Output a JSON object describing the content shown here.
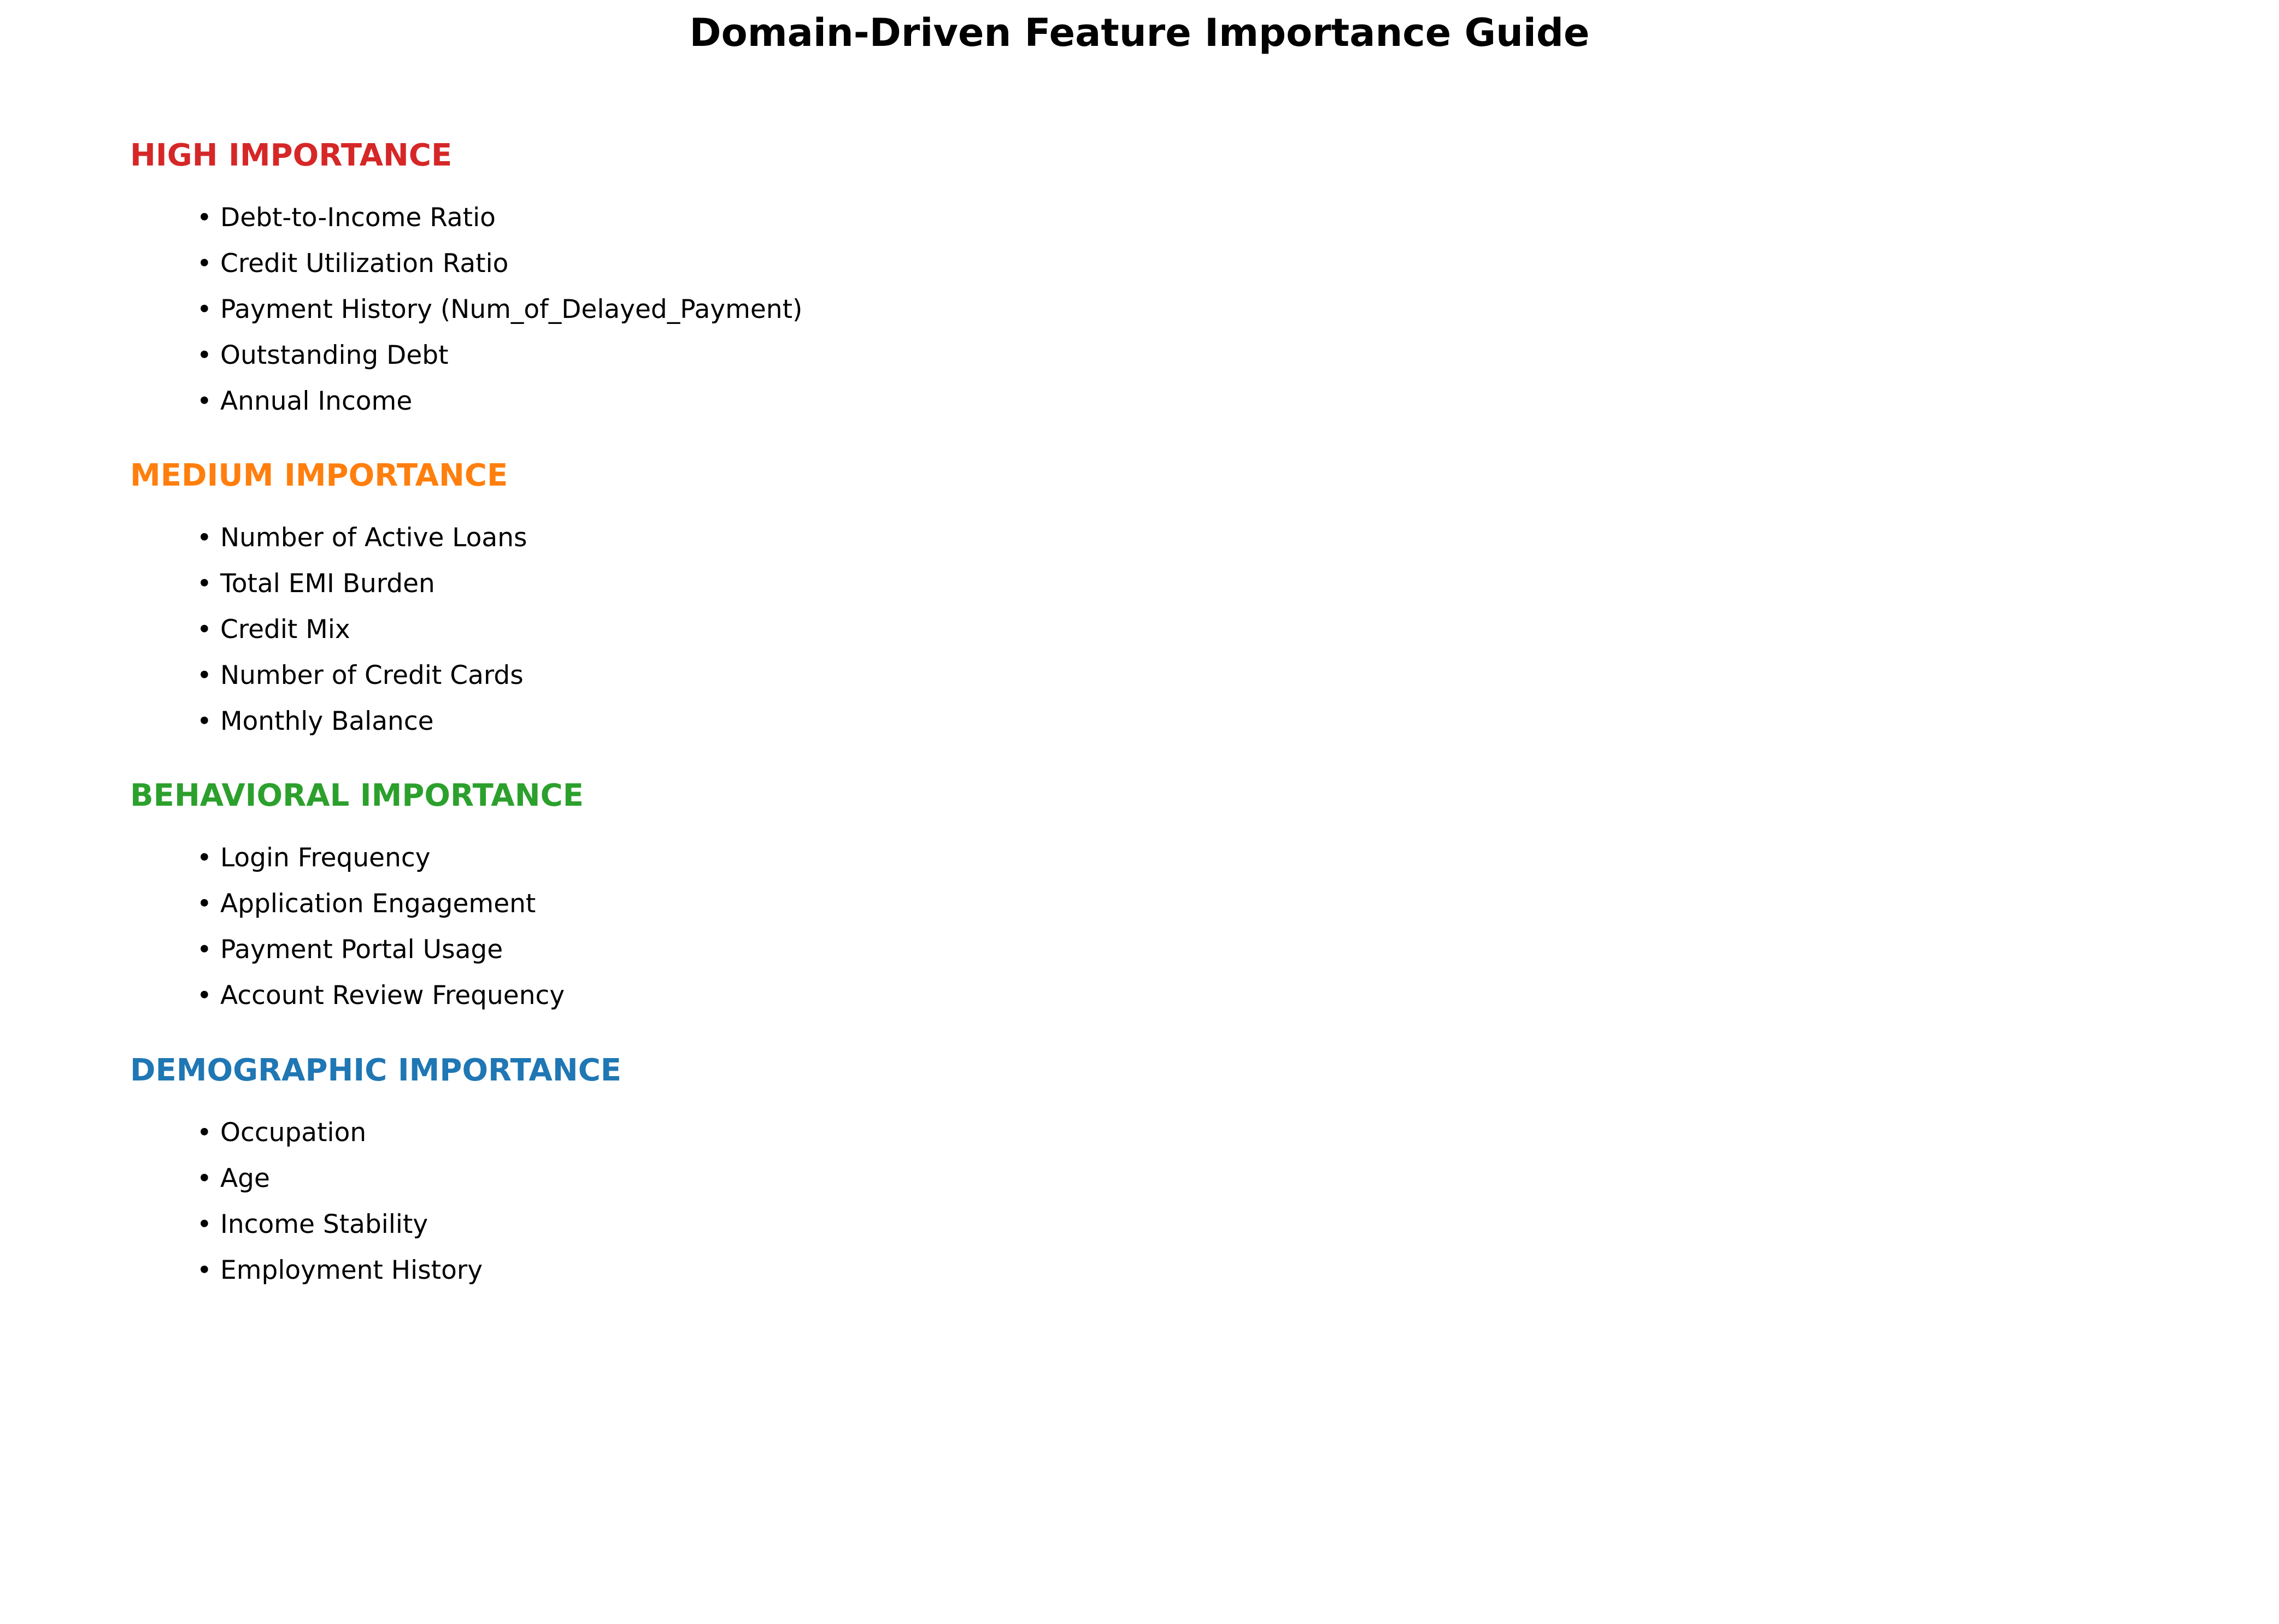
{
  "title": "Domain-Driven Feature Importance Guide",
  "colors": {
    "high": "#d62728",
    "medium": "#ff7f0e",
    "behavioral": "#2ca02c",
    "demographic": "#1f77b4"
  },
  "bullet": "•",
  "sections": [
    {
      "heading": "HIGH IMPORTANCE",
      "items": [
        "Debt-to-Income Ratio",
        "Credit Utilization Ratio",
        "Payment History (Num_of_Delayed_Payment)",
        "Outstanding Debt",
        "Annual Income"
      ]
    },
    {
      "heading": "MEDIUM IMPORTANCE",
      "items": [
        "Number of Active Loans",
        "Total EMI Burden",
        "Credit Mix",
        "Number of Credit Cards",
        "Monthly Balance"
      ]
    },
    {
      "heading": "BEHAVIORAL IMPORTANCE",
      "items": [
        "Login Frequency",
        "Application Engagement",
        "Payment Portal Usage",
        "Account Review Frequency"
      ]
    },
    {
      "heading": "DEMOGRAPHIC IMPORTANCE",
      "items": [
        "Occupation",
        "Age",
        "Income Stability",
        "Employment History"
      ]
    }
  ]
}
